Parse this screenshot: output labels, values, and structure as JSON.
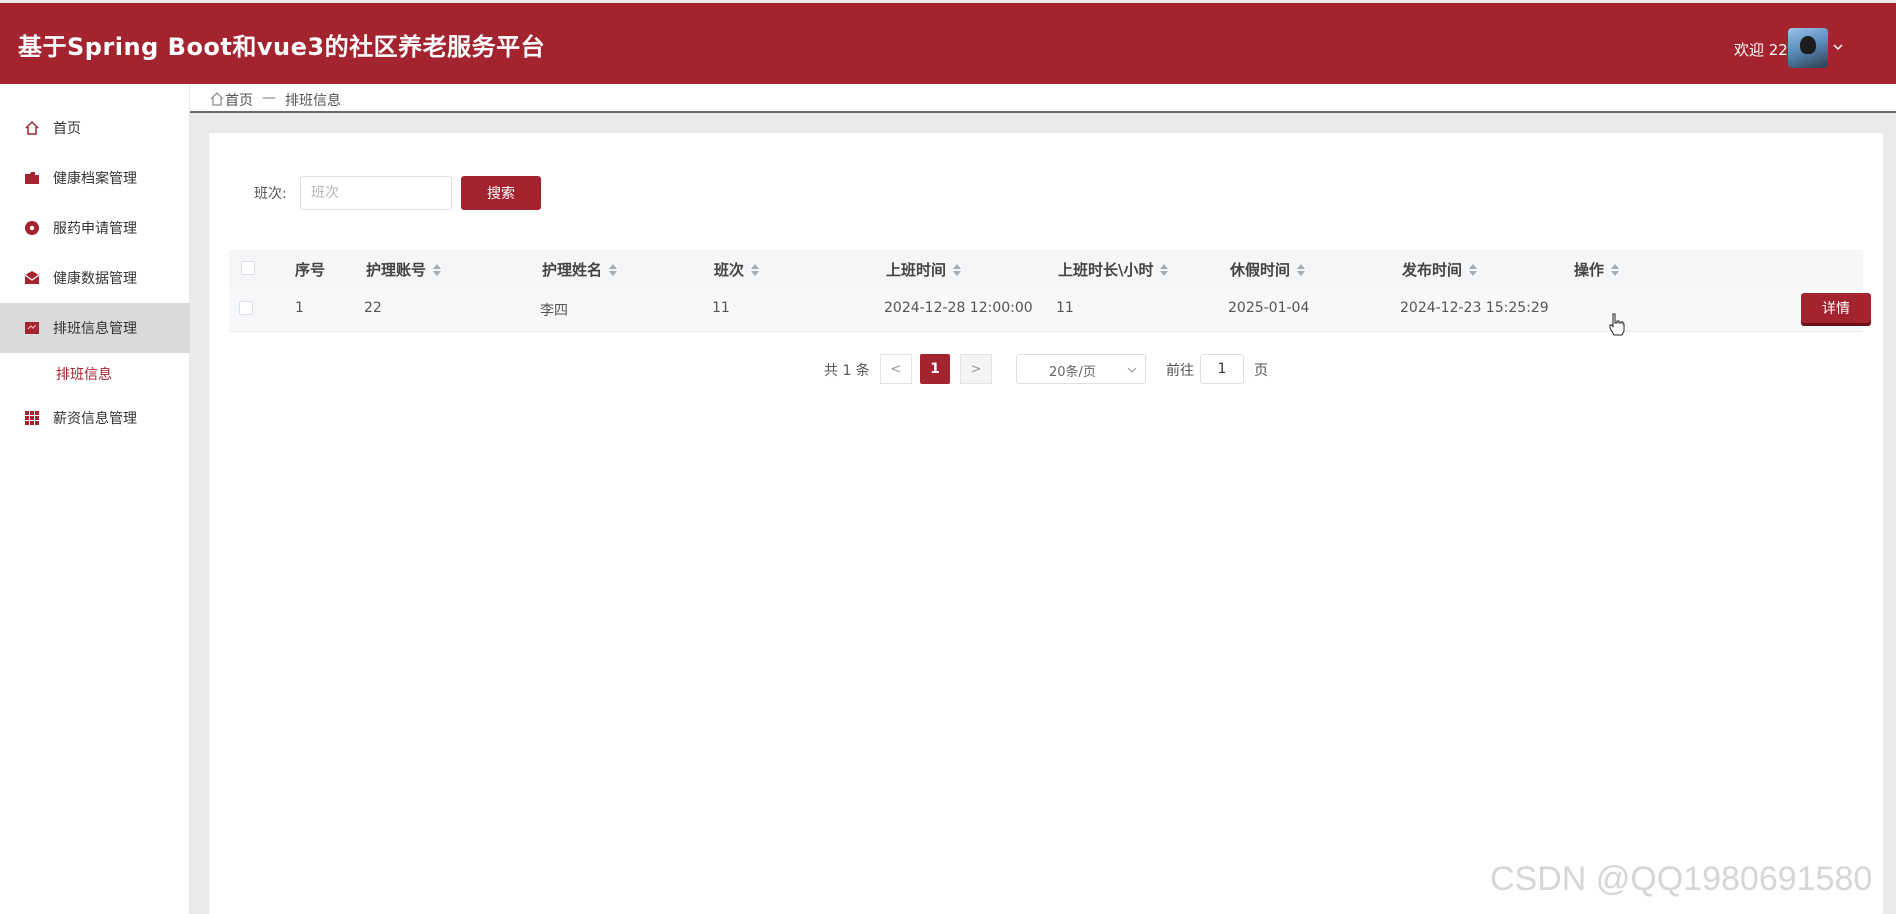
{
  "app": {
    "title": "基于Spring Boot和vue3的社区养老服务平台",
    "welcome": "欢迎 22",
    "brand_color": "#a3232f"
  },
  "sidebar": {
    "items": [
      {
        "label": "首页",
        "icon": "home-icon"
      },
      {
        "label": "健康档案管理",
        "icon": "folder-icon"
      },
      {
        "label": "服药申请管理",
        "icon": "pill-icon"
      },
      {
        "label": "健康数据管理",
        "icon": "mail-icon"
      },
      {
        "label": "排班信息管理",
        "icon": "calendar-icon",
        "active": true
      },
      {
        "label": "薪资信息管理",
        "icon": "grid-icon"
      }
    ],
    "submenu": {
      "label": "排班信息"
    }
  },
  "breadcrumb": {
    "home": "首页",
    "separator": "—",
    "current": "排班信息"
  },
  "search": {
    "label": "班次:",
    "placeholder": "班次",
    "value": "",
    "button": "搜索"
  },
  "table": {
    "columns": [
      "序号",
      "护理账号",
      "护理姓名",
      "班次",
      "上班时间",
      "上班时长\\小时",
      "休假时间",
      "发布时间",
      "操作"
    ],
    "rows": [
      {
        "index": "1",
        "account": "22",
        "name": "李四",
        "shift": "11",
        "start_time": "2024-12-28 12:00:00",
        "duration": "11",
        "leave_date": "2025-01-04",
        "published": "2024-12-23 15:25:29",
        "action": "详情"
      }
    ]
  },
  "pagination": {
    "total": "共 1 条",
    "prev": "<",
    "current": "1",
    "next": ">",
    "page_size": "20条/页",
    "goto_label": "前往",
    "goto_value": "1",
    "page_suffix": "页"
  },
  "watermark": "CSDN @QQ1980691580"
}
